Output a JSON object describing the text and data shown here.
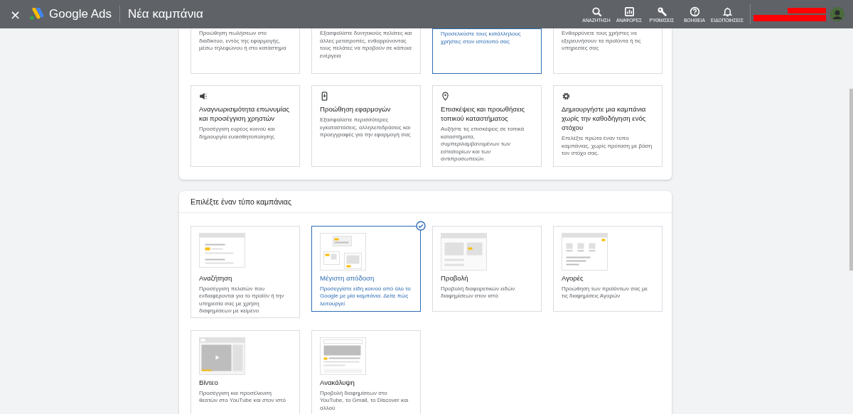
{
  "header": {
    "close": "×",
    "product": "Google Ads",
    "page_title": "Νέα καμπάνια",
    "actions": [
      {
        "label": "ΑΝΑΖΗΤΗΣΗ"
      },
      {
        "label": "ΑΝΑΦΟΡΕΣ"
      },
      {
        "label": "ΡΥΘΜΙΣΕΙΣ"
      },
      {
        "label": "ΒΟΗΘΕΙΑ"
      },
      {
        "label": "ΕΙΔΟΠΟΙΗΣΕΙΣ"
      }
    ]
  },
  "goals": {
    "partial_row": [
      {
        "description": "Προώθηση πωλήσεων στο διαδίκτυο, εντός της εφαρμογής, μέσω τηλεφώνου ή στο κατάστημα",
        "selected": false
      },
      {
        "description": "Εξασφαλίστε δυνητικούς πελάτες και άλλες μετατροπές, ενθαρρύνοντας τους πελάτες να προβούν σε κάποια ενέργεια",
        "selected": false
      },
      {
        "description": "Προσελκύστε τους κατάλληλους χρήστες στον ιστότοπό σας",
        "selected": true
      },
      {
        "description": "Ενθαρρύνετε τους χρήστες να εξερευνήσουν τα προϊόντα ή τις υπηρεσίες σας",
        "selected": false
      }
    ],
    "items": [
      {
        "title": "Αναγνωρισιμότητα επωνυμίας και προσέγγιση χρηστών",
        "description": "Προσέγγιση ευρέος κοινού και δημιουργία ευαισθητοποίησης",
        "selected": false
      },
      {
        "title": "Προώθηση εφαρμογών",
        "description": "Εξασφαλίστε περισσότερες εγκαταστάσεις, αλληλεπιδράσεις και προεγγραφές για την εφαρμογή σας",
        "selected": false
      },
      {
        "title": "Επισκέψεις και προωθήσεις τοπικού καταστήματος",
        "description": "Αυξήστε τις επισκέψεις σε τοπικά καταστήματα, συμπεριλαμβανομένων των εστιατορίων και των αντιπροσωπειών.",
        "selected": false
      },
      {
        "title": "Δημιουργήστε μια καμπάνια χωρίς την καθοδήγηση ενός στόχου",
        "description": "Επιλέξτε πρώτα έναν τύπο καμπάνιας, χωρίς πρόταση με βάση τον στόχο σας.",
        "selected": false
      }
    ]
  },
  "campaign_types": {
    "heading": "Επιλέξτε έναν τύπο καμπάνιας",
    "items": [
      {
        "title": "Αναζήτηση",
        "description": "Προσέγγιση πελατών που ενδιαφέρονται για το προϊόν ή την υπηρεσία σας με χρήση διαφημίσεων με κείμενο",
        "selected": false
      },
      {
        "title": "Μέγιστη απόδοση",
        "description": "Προσεγγίστε είδη κοινού από όλο το Google με μία καμπάνια.  Δείτε πώς λειτουργεί",
        "selected": true
      },
      {
        "title": "Προβολή",
        "description": "Προβολή διαφορετικών ειδών διαφημίσεων στον ιστό",
        "selected": false
      },
      {
        "title": "Αγορές",
        "description": "Προώθηση των προϊόντων σας με τις διαφημίσεις Αγορών",
        "selected": false
      },
      {
        "title": "Βίντεο",
        "description": "Προσέγγιση και προσέλκυση θεατών στο YouTube και στον ιστό",
        "selected": false
      },
      {
        "title": "Ανακάλυψη",
        "description": "Προβολή διαφημίσεων στο YouTube, το Gmail, το Discover και αλλού",
        "selected": false
      }
    ]
  }
}
